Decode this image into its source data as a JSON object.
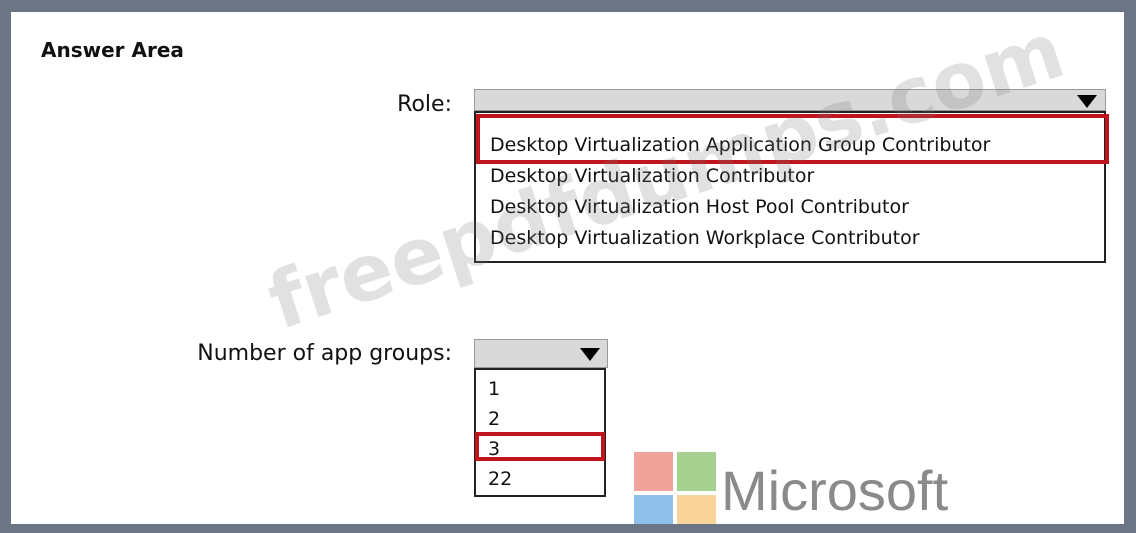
{
  "header": {
    "title": "Answer Area"
  },
  "role": {
    "label": "Role:",
    "selected": "",
    "options": [
      "Desktop Virtualization Application Group Contributor",
      "Desktop Virtualization Contributor",
      "Desktop Virtualization Host Pool Contributor",
      "Desktop Virtualization Workplace Contributor"
    ],
    "highlighted_option": "Desktop Virtualization Application Group Contributor"
  },
  "app_groups": {
    "label": "Number of app groups:",
    "selected": "",
    "options": [
      "1",
      "2",
      "3",
      "22"
    ],
    "highlighted_option": "3"
  },
  "watermark": {
    "text": "freepdfdumps.com"
  },
  "brand": {
    "name": "Microsoft",
    "colors": [
      "#f0a39a",
      "#a6d08f",
      "#8fc0ea",
      "#f8d49a"
    ],
    "highlight_color": "#c0151c"
  }
}
